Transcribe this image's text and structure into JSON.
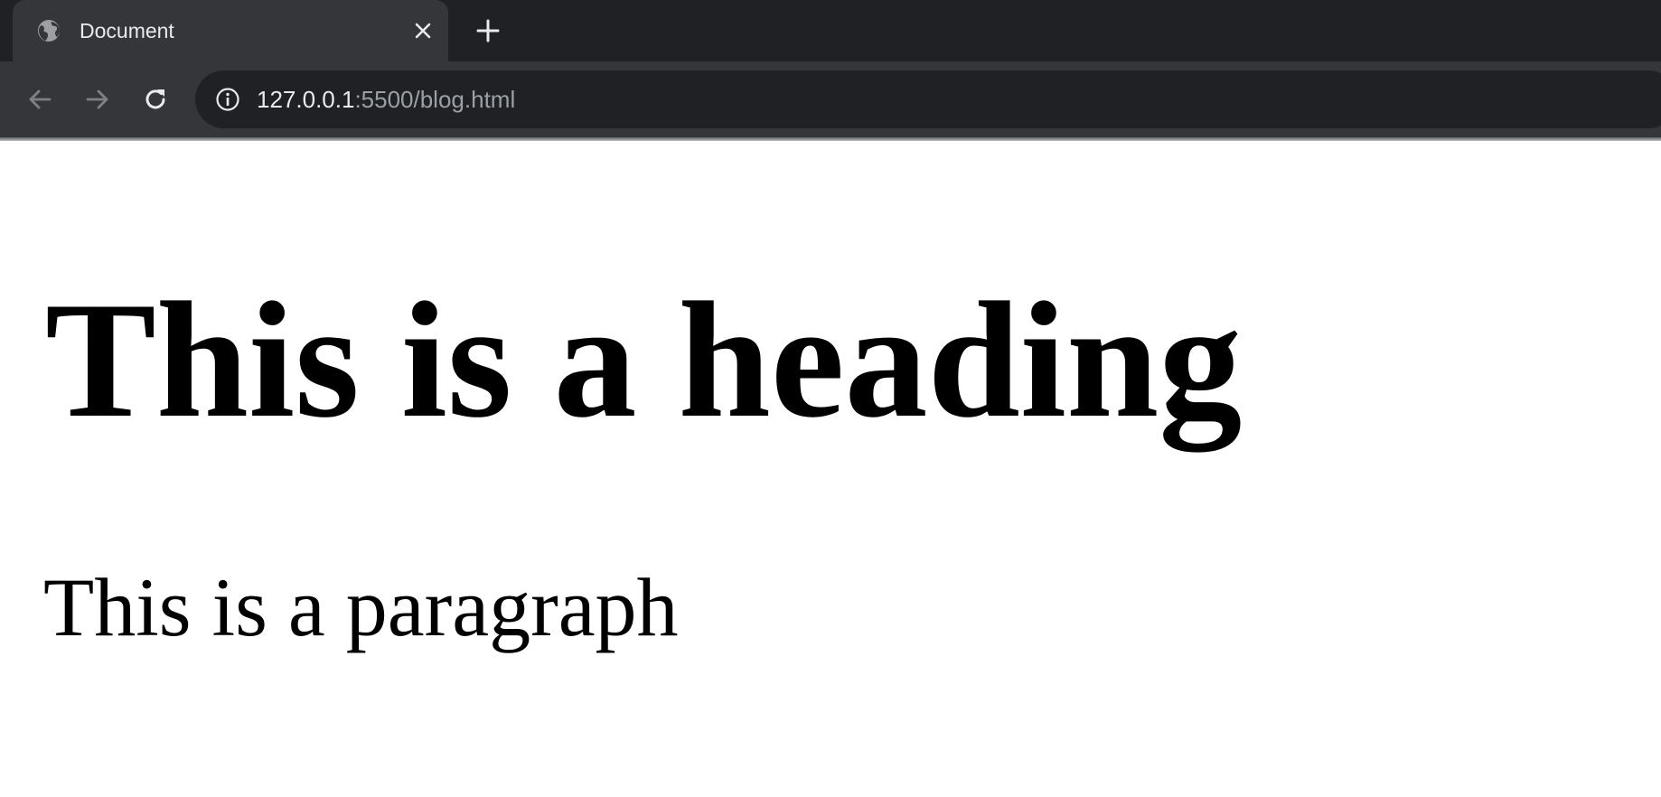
{
  "browser": {
    "tab": {
      "title": "Document",
      "favicon": "globe-icon"
    },
    "address_bar": {
      "host": "127.0.0.1",
      "rest": ":5500/blog.html",
      "site_info_icon": "info-icon"
    },
    "icons": {
      "back": "arrow-left-icon",
      "forward": "arrow-right-icon",
      "reload": "reload-icon",
      "close_tab": "close-icon",
      "new_tab": "plus-icon"
    },
    "colors": {
      "tabstrip_bg": "#202124",
      "active_tab_bg": "#35363a",
      "omnibox_bg": "#202124",
      "text_primary": "#e8eaed",
      "text_secondary": "#9aa0a6"
    }
  },
  "page": {
    "heading": "This is a heading",
    "paragraph": "This is a paragraph"
  }
}
